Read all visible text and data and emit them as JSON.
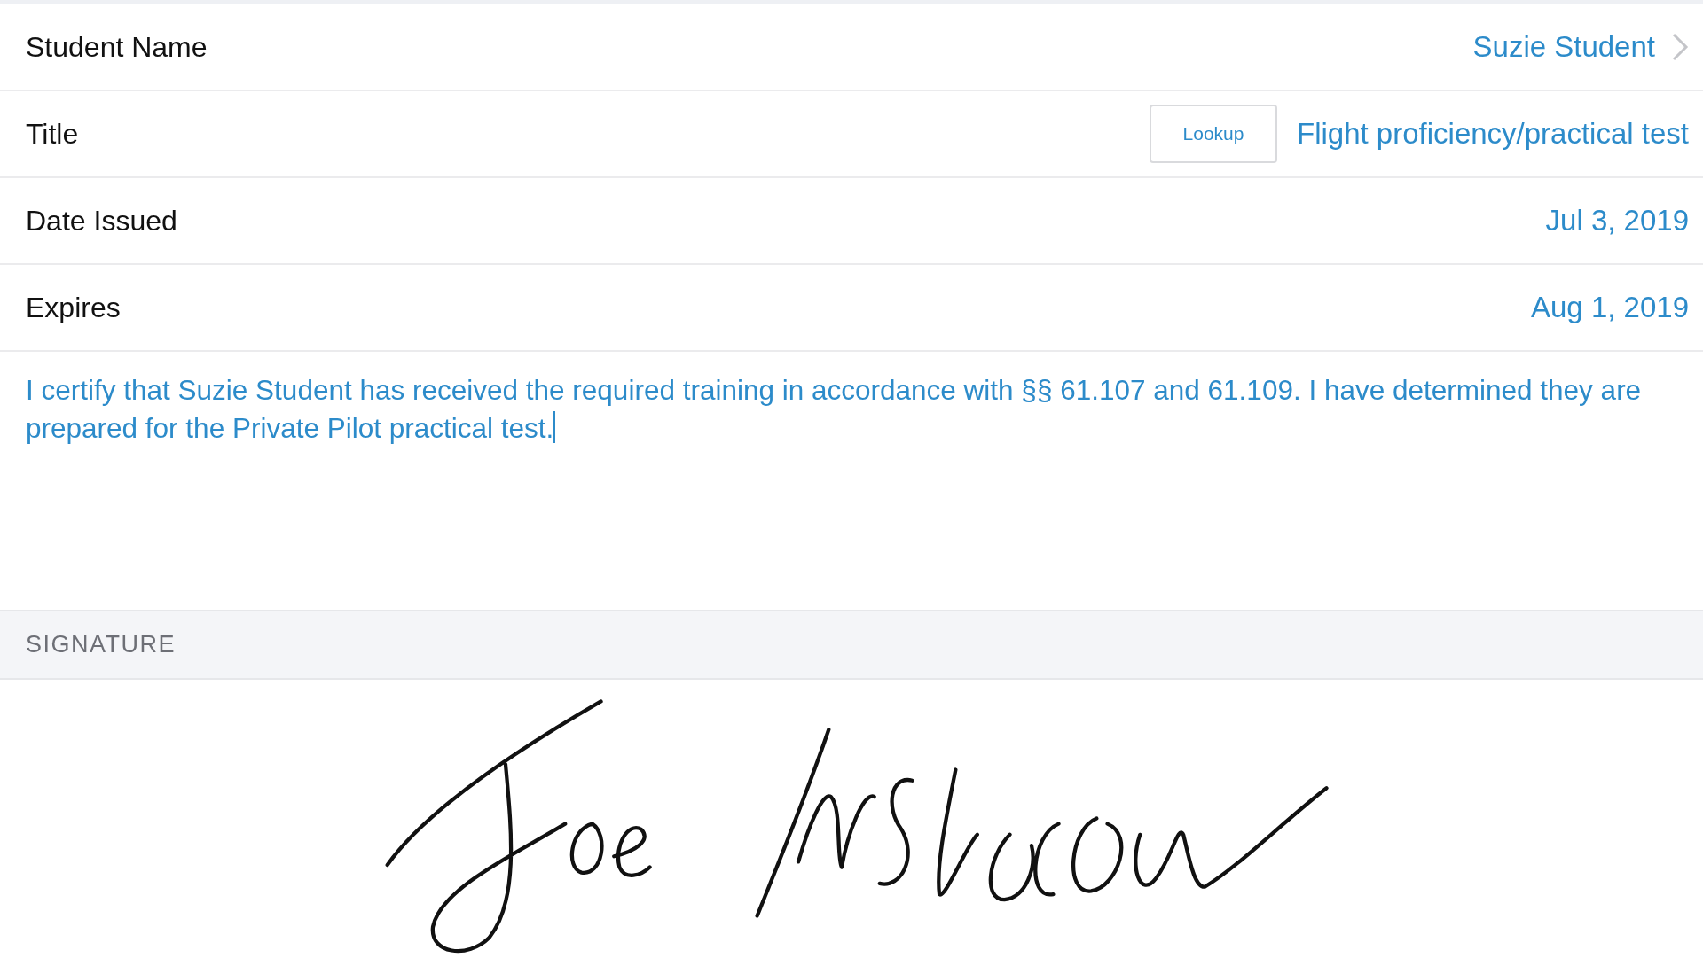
{
  "fields": [
    {
      "kind": "link",
      "label": "Student Name",
      "value": "Suzie Student"
    },
    {
      "kind": "lookup",
      "label": "Title",
      "button": "Lookup",
      "value": "Flight proficiency/practical test"
    },
    {
      "kind": "plain",
      "label": "Date Issued",
      "value": "Jul 3, 2019"
    },
    {
      "kind": "plain",
      "label": "Expires",
      "value": "Aug 1, 2019"
    }
  ],
  "certification": {
    "text": "I certify that Suzie Student has received the required training in accordance with §§ 61.107 and 61.109. I have determined they are prepared for the Private Pilot practical test.",
    "editing": true
  },
  "signature": {
    "header": "SIGNATURE",
    "signed": true
  }
}
